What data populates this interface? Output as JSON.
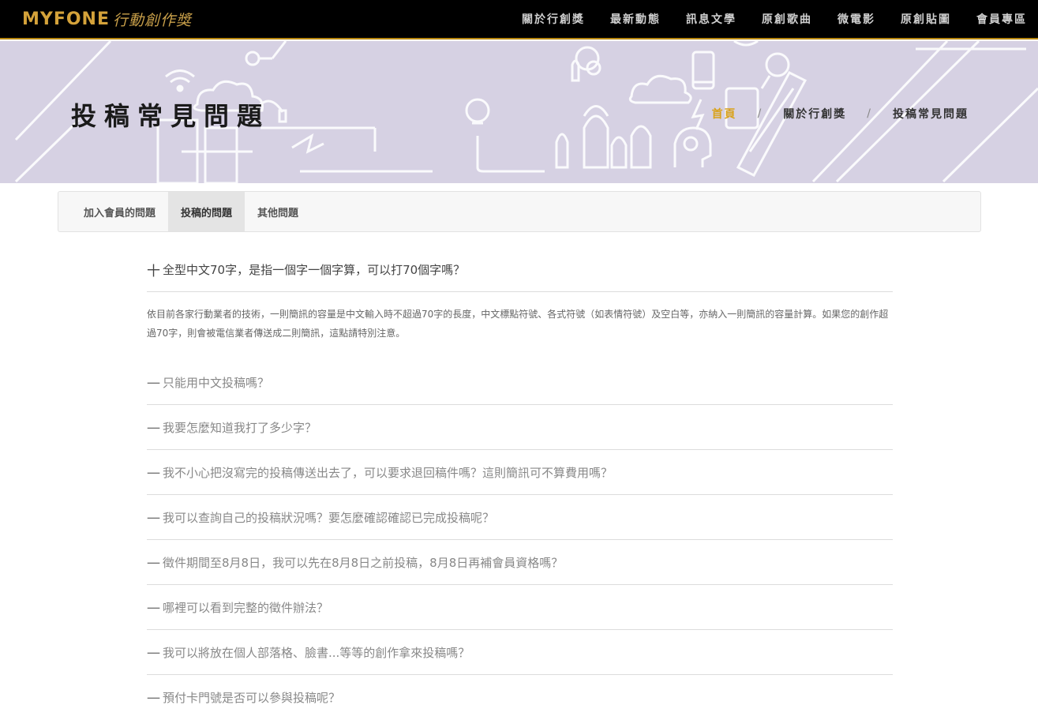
{
  "header": {
    "logo_latin": "MYFONE",
    "logo_cjk": "行動創作獎",
    "nav": [
      "關於行創獎",
      "最新動態",
      "訊息文學",
      "原創歌曲",
      "微電影",
      "原創貼圖",
      "會員專區"
    ]
  },
  "hero": {
    "title": "投稿常見問題",
    "breadcrumb": {
      "home": "首頁",
      "sep": "/",
      "parent": "關於行創獎",
      "current": "投稿常見問題"
    }
  },
  "tabs": [
    "加入會員的問題",
    "投稿的問題",
    "其他問題"
  ],
  "active_tab": 1,
  "faq": {
    "open_symbol": "十",
    "closed_symbol": "一",
    "open_question": "全型中文70字，是指一個字一個字算，可以打70個字嗎？",
    "open_answer": "依目前各家行動業者的技術，一則簡訊的容量是中文輸入時不超過70字的長度，中文標點符號、各式符號（如表情符號）及空白等，亦納入一則簡訊的容量計算。如果您的創作超過70字，則會被電信業者傳送成二則簡訊，這點請特別注意。",
    "questions": [
      "只能用中文投稿嗎？",
      "我要怎麼知道我打了多少字？",
      "我不小心把沒寫完的投稿傳送出去了，可以要求退回稿件嗎？這則簡訊可不算費用嗎？",
      "我可以查詢自己的投稿狀況嗎？要怎麼確認確認已完成投稿呢？",
      "徵件期間至8月8日，我可以先在8月8日之前投稿，8月8日再補會員資格嗎？",
      "哪裡可以看到完整的徵件辦法？",
      "我可以將放在個人部落格、臉書...等等的創作拿來投稿嗎？",
      "預付卡門號是否可以參與投稿呢？"
    ]
  },
  "colors": {
    "accent": "#d9a21a",
    "hero_bg": "#d6d1e3",
    "topbar_bg": "#000000"
  }
}
